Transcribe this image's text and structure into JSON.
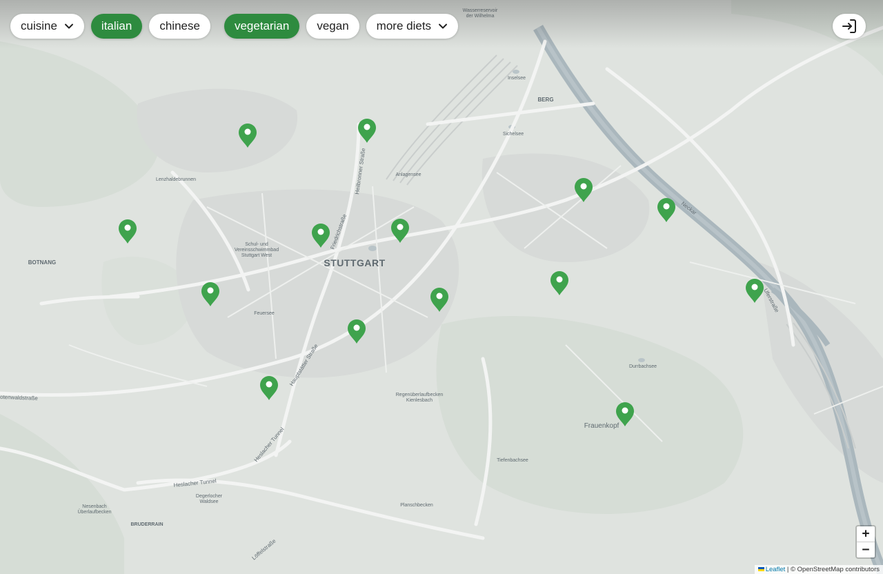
{
  "filters": {
    "cuisine_label": "cuisine",
    "chips": [
      {
        "label": "italian",
        "active": true
      },
      {
        "label": "chinese",
        "active": false
      }
    ],
    "diet_chips": [
      {
        "label": "vegetarian",
        "active": true
      },
      {
        "label": "vegan",
        "active": false
      }
    ],
    "more_diets_label": "more diets"
  },
  "login": {
    "icon": "login-icon"
  },
  "map": {
    "city_label": "STUTTGART",
    "place_labels": {
      "berg": "BERG",
      "botnang": "BOTNANG",
      "bruderrain": "BRUDERRAIN",
      "frauenkopf": "Frauenkopf",
      "lenzhalde": "Lenzhaldebrunnen",
      "inselsee": "Inselsee",
      "sichelsee": "Sichelsee",
      "anlagensee": "Anlagensee",
      "feuersee": "Feuersee",
      "durrbachsee": "Durrbachsee",
      "tiefenbachsee": "Tiefenbachsee",
      "planschbecken": "Planschbecken",
      "regenueberlauf1": "Regenüberlaufbecken",
      "regenueberlauf2": "Kienlesbach",
      "schwimmbad1": "Schul- und",
      "schwimmbad2": "Vereinsschwimmbad",
      "schwimmbad3": "Stuttgart West",
      "degerloch1": "Degerlocher",
      "degerloch2": "Waldsee",
      "nesenbach1": "Nesenbach",
      "nesenbach2": "Überlaufbecken",
      "wasserreservoir1": "Wasserreservoir",
      "wasserreservoir2": "der Wilhelma"
    },
    "street_labels": {
      "heilbronner": "Heilbronner Straße",
      "friedrich": "Friedrichstraße",
      "hauptstaetter": "Hauptstätter Straße",
      "heslacher_tunnel": "Heslacher Tunnel",
      "heslacher_tunnel2": "Heslacher Tunnel",
      "rotenwald": "otenwaldstraße",
      "loeffel": "Löffelstraße",
      "neckar": "Neckar",
      "ufer": "Uferstraße"
    },
    "marker_count": 15,
    "marker_color": "#3fa34d",
    "water_color": "#aab7bd"
  },
  "zoom": {
    "in_label": "+",
    "out_label": "−"
  },
  "attribution": {
    "leaflet": "Leaflet",
    "separator": " | © ",
    "osm": "OpenStreetMap contributors"
  }
}
